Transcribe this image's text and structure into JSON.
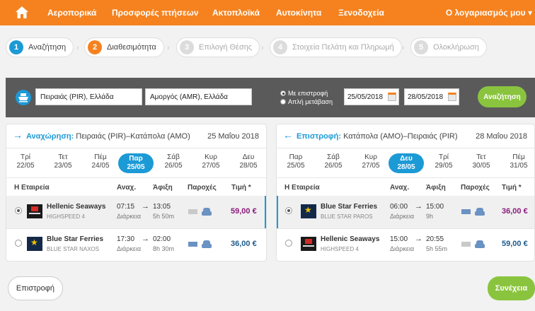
{
  "nav": {
    "items": [
      "Αεροπορικά",
      "Προσφορές πτήσεων",
      "Ακτοπλοϊκά",
      "Αυτοκίνητα",
      "Ξενοδοχεία"
    ],
    "account": "Ο λογαριασμός μου ▾"
  },
  "steps": [
    {
      "num": "1",
      "label": "Αναζήτηση"
    },
    {
      "num": "2",
      "label": "Διαθεσιμότητα"
    },
    {
      "num": "3",
      "label": "Επιλογή Θέσης"
    },
    {
      "num": "4",
      "label": "Στοιχεία Πελάτη και Πληρωμή"
    },
    {
      "num": "5",
      "label": "Ολοκλήρωση"
    }
  ],
  "search": {
    "from": "Πειραιάς (PIR), Ελλάδα",
    "to": "Αμοργός (AMR), Ελλάδα",
    "round_trip": "Με επιστροφή",
    "one_way": "Απλή μετάβαση",
    "depart_date": "25/05/2018",
    "return_date": "28/05/2018",
    "search_button": "Αναζήτηση"
  },
  "outbound": {
    "title_bold": "Αναχώρηση:",
    "title_route": " Πειραιάς (PIR)–Κατάπολα (AMO)",
    "date": "25 Μαΐου 2018",
    "days": [
      {
        "d": "Τρί",
        "n": "22/05"
      },
      {
        "d": "Τετ",
        "n": "23/05"
      },
      {
        "d": "Πέμ",
        "n": "24/05"
      },
      {
        "d": "Παρ",
        "n": "25/05"
      },
      {
        "d": "Σάβ",
        "n": "26/05"
      },
      {
        "d": "Κυρ",
        "n": "27/05"
      },
      {
        "d": "Δευ",
        "n": "28/05"
      }
    ],
    "headers": {
      "company": "Η Εταιρεία",
      "dep": "Αναχ.",
      "arr": "Άφιξη",
      "services": "Παροχές",
      "price": "Τιμή *"
    },
    "rows": [
      {
        "company": "Hellenic Seaways",
        "vessel": "HIGHSPEED 4",
        "dep": "07:15",
        "arr": "13:05",
        "dur_label": "Διάρκεια",
        "dur": "5h 50m",
        "price": "59,00 €"
      },
      {
        "company": "Blue Star Ferries",
        "vessel": "BLUE STAR NAXOS",
        "dep": "17:30",
        "arr": "02:00",
        "dur_label": "Διάρκεια",
        "dur": "8h 30m",
        "price": "36,00 €"
      }
    ]
  },
  "return": {
    "title_bold": "Επιστροφή:",
    "title_route": " Κατάπολα (AMO)–Πειραιάς (PIR)",
    "date": "28 Μαΐου 2018",
    "days": [
      {
        "d": "Παρ",
        "n": "25/05"
      },
      {
        "d": "Σάβ",
        "n": "26/05"
      },
      {
        "d": "Κυρ",
        "n": "27/05"
      },
      {
        "d": "Δευ",
        "n": "28/05"
      },
      {
        "d": "Τρί",
        "n": "29/05"
      },
      {
        "d": "Τετ",
        "n": "30/05"
      },
      {
        "d": "Πέμ",
        "n": "31/05"
      }
    ],
    "headers": {
      "company": "Η Εταιρεία",
      "dep": "Αναχ.",
      "arr": "Άφιξη",
      "services": "Παροχές",
      "price": "Τιμή *"
    },
    "rows": [
      {
        "company": "Blue Star Ferries",
        "vessel": "BLUE STAR PAROS",
        "dep": "06:00",
        "arr": "15:00",
        "dur_label": "Διάρκεια",
        "dur": "9h",
        "price": "36,00 €"
      },
      {
        "company": "Hellenic Seaways",
        "vessel": "HIGHSPEED 4",
        "dep": "15:00",
        "arr": "20:55",
        "dur_label": "Διάρκεια",
        "dur": "5h 55m",
        "price": "59,00 €"
      }
    ]
  },
  "footer": {
    "back": "Επιστροφή",
    "continue": "Συνέχεια"
  }
}
